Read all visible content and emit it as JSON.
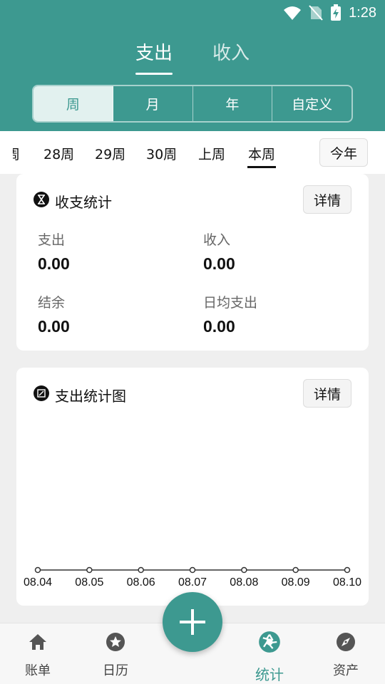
{
  "status": {
    "time": "1:28"
  },
  "tabs": {
    "expense": "支出",
    "income": "收入"
  },
  "segments": [
    "周",
    "月",
    "年",
    "自定义"
  ],
  "periods": {
    "partial": "周",
    "items": [
      "28周",
      "29周",
      "30周",
      "上周",
      "本周"
    ],
    "year_button": "今年"
  },
  "summary_card": {
    "title": "收支统计",
    "detail": "详情",
    "stats": [
      {
        "label": "支出",
        "value": "0.00"
      },
      {
        "label": "收入",
        "value": "0.00"
      },
      {
        "label": "结余",
        "value": "0.00"
      },
      {
        "label": "日均支出",
        "value": "0.00"
      }
    ]
  },
  "chart_card": {
    "title": "支出统计图",
    "detail": "详情"
  },
  "chart_data": {
    "type": "line",
    "x": [
      "08.04",
      "08.05",
      "08.06",
      "08.07",
      "08.08",
      "08.09",
      "08.10"
    ],
    "series": [
      {
        "values": [
          0,
          0,
          0,
          0,
          0,
          0,
          0
        ]
      }
    ],
    "grid": false,
    "ylim": [
      0,
      1
    ]
  },
  "nav": {
    "ledger": "账单",
    "calendar": "日历",
    "stats": "统计",
    "assets": "资产"
  },
  "colors": {
    "accent": "#3d9990"
  }
}
